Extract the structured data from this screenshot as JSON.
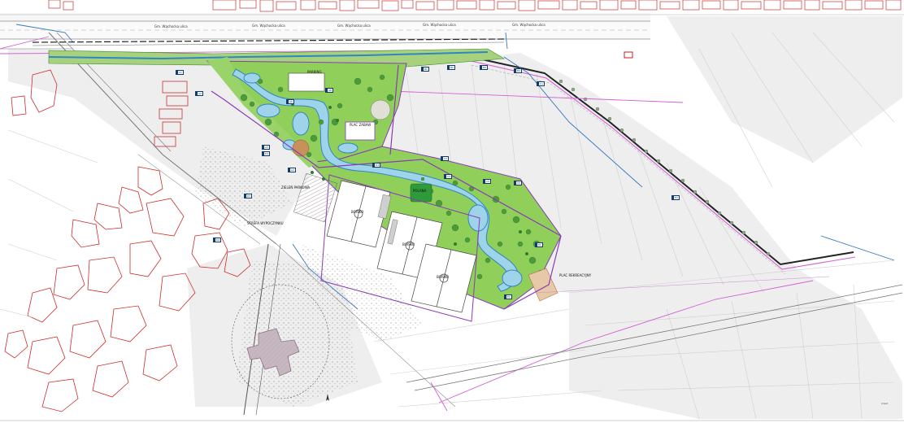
{
  "map": {
    "title": "",
    "legend": [],
    "colors": {
      "background": "#ffffff",
      "paper_gray": "#ededed",
      "parcel_line": "#d8d8d8",
      "building_red": "#cc2d2d",
      "park_green": "#8fcf5a",
      "park_green_dark": "#5fa63a",
      "tree_dark": "#2f7d2a",
      "water_fill": "#9fd3ea",
      "water_edge": "#2f86c4",
      "purple_boundary": "#8a3ab9",
      "magenta_utility": "#d45fd6",
      "blue_utility": "#3578c2",
      "road_dark": "#444444",
      "football_pitch": "#ffffff",
      "sand_playground": "#e7c8a8",
      "hospital_fill": "#c7b7c0"
    },
    "road_labels": [
      "Gm. Wąchocka ulica",
      "Gm. Wąchocka ulica",
      "Gm. Wąchocka ulica",
      "Gm. Wąchocka ulica",
      "Gm. Wąchocka ulica"
    ],
    "site_labels": [
      "PARKING",
      "PLAC ZABAW",
      "BOISKO",
      "BOISKO",
      "BOISKO",
      "POLANA",
      "PLAC REKREACYJNY",
      "ZIELEŃ PARKOWA",
      "STREFA WYPOCZYNKU"
    ],
    "signs": [
      "A1",
      "A2",
      "A3",
      "A4",
      "A5",
      "A6",
      "B1",
      "B2",
      "B3",
      "B4",
      "C1",
      "C2",
      "C3",
      "C4",
      "C5",
      "D1",
      "D2",
      "D3",
      "D4",
      "E1",
      "E2",
      "E3"
    ],
    "north_icon": "north-arrow-icon",
    "stamp": "sheet"
  }
}
